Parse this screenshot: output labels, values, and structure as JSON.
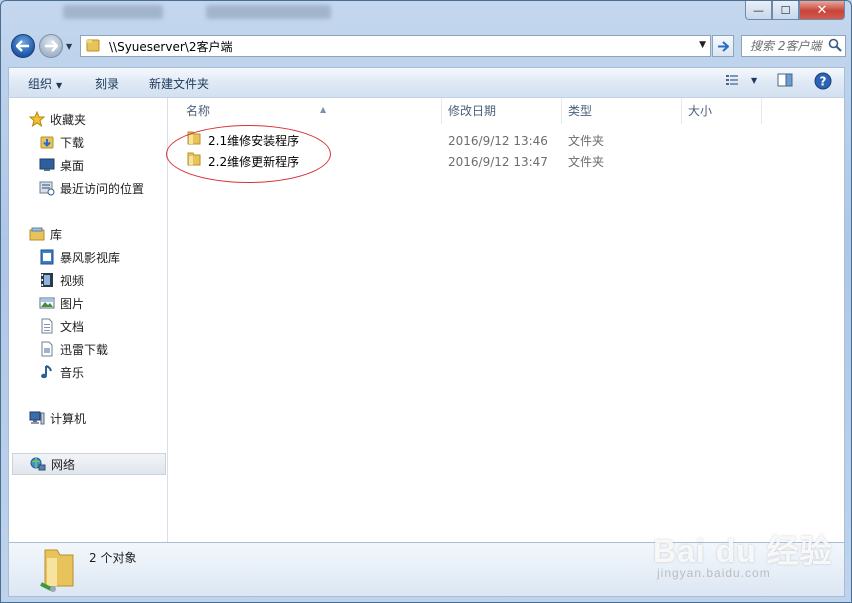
{
  "window": {
    "address_path": "\\\\Syueserver\\2客户端",
    "search_placeholder": "搜索 2客户端",
    "controls": {
      "minimize": "—",
      "maximize": "☐",
      "close": "✕"
    }
  },
  "toolbar": {
    "organize": "组织",
    "burn": "刻录",
    "new_folder": "新建文件夹"
  },
  "sidebar": {
    "favorites": {
      "label": "收藏夹",
      "items": [
        {
          "label": "下载",
          "icon": "download-folder-icon"
        },
        {
          "label": "桌面",
          "icon": "desktop-icon"
        },
        {
          "label": "最近访问的位置",
          "icon": "recent-places-icon"
        }
      ]
    },
    "libraries": {
      "label": "库",
      "items": [
        {
          "label": "暴风影视库",
          "icon": "media-library-icon"
        },
        {
          "label": "视频",
          "icon": "video-icon"
        },
        {
          "label": "图片",
          "icon": "pictures-icon"
        },
        {
          "label": "文档",
          "icon": "documents-icon"
        },
        {
          "label": "迅雷下载",
          "icon": "thunder-download-icon"
        },
        {
          "label": "音乐",
          "icon": "music-icon"
        }
      ]
    },
    "computer": {
      "label": "计算机"
    },
    "network": {
      "label": "网络"
    }
  },
  "columns": {
    "name": "名称",
    "date": "修改日期",
    "type": "类型",
    "size": "大小"
  },
  "files": [
    {
      "name": "2.1维修安装程序",
      "date": "2016/9/12 13:46",
      "type": "文件夹"
    },
    {
      "name": "2.2维修更新程序",
      "date": "2016/9/12 13:47",
      "type": "文件夹"
    }
  ],
  "status": {
    "count_text": "2 个对象"
  },
  "watermark": {
    "logo": "Bai du 经验",
    "site": "jingyan.baidu.com"
  },
  "colors": {
    "annotation_ellipse": "#d8323a",
    "folder": "#e8c25a"
  }
}
